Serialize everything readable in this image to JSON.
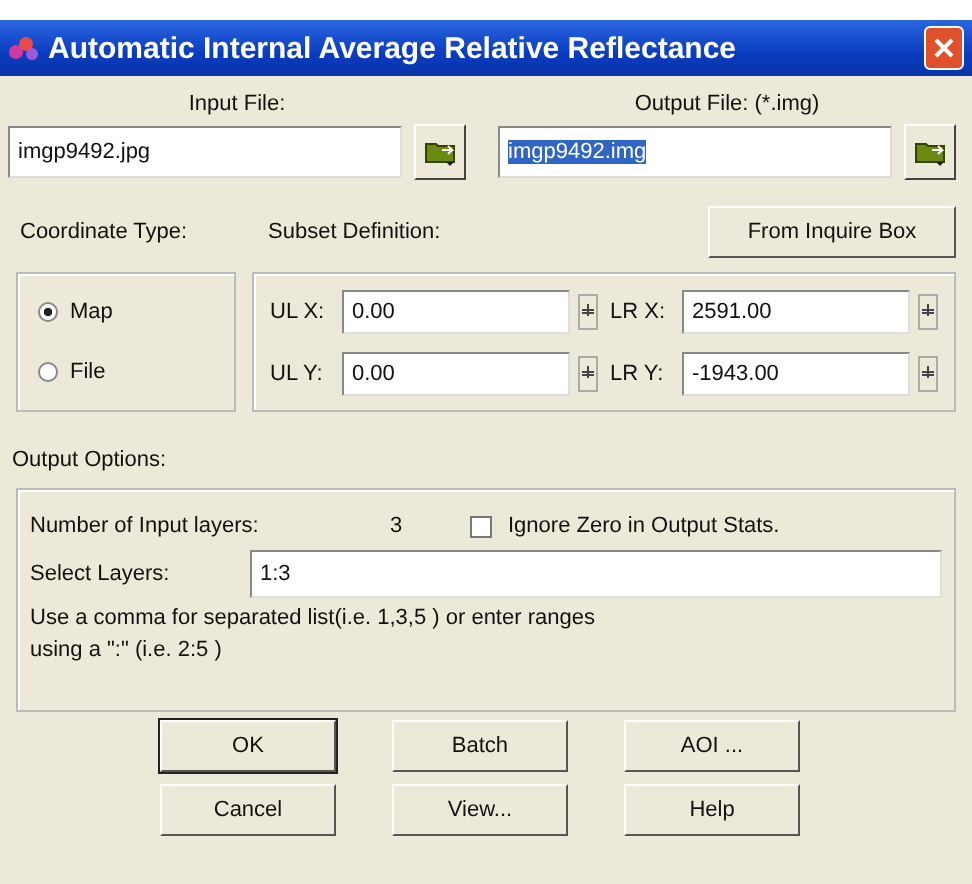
{
  "window": {
    "title": "Automatic Internal Average Relative Reflectance"
  },
  "files": [
    {
      "label": "Input File:",
      "value": "imgp9492.jpg",
      "selected": false
    },
    {
      "label": "Output File: (*.img)",
      "value": "imgp9492.img",
      "selected": true
    }
  ],
  "coordinate_type": {
    "label": "Coordinate Type:",
    "options": [
      {
        "label": "Map",
        "selected": true
      },
      {
        "label": "File",
        "selected": false
      }
    ]
  },
  "subset": {
    "label": "Subset Definition:",
    "button": "From Inquire Box",
    "fields": [
      {
        "label": "UL X:",
        "value": "0.00"
      },
      {
        "label": "LR X:",
        "value": "2591.00"
      },
      {
        "label": "UL Y:",
        "value": "0.00"
      },
      {
        "label": "LR Y:",
        "value": "-1943.00"
      }
    ]
  },
  "output_options": {
    "label": "Output Options:",
    "layers_label": "Number of Input layers:",
    "layers_count": "3",
    "ignore_zero": {
      "label": "Ignore Zero in Output Stats.",
      "checked": false
    },
    "select_label": "Select Layers:",
    "select_value": "1:3",
    "hint": [
      "Use a comma for separated list(i.e. 1,3,5 ) or enter ranges",
      "using a \":\" (i.e. 2:5 )"
    ]
  },
  "buttons": [
    {
      "label": "OK",
      "default": true
    },
    {
      "label": "Batch",
      "default": false
    },
    {
      "label": "AOI ...",
      "default": false
    },
    {
      "label": "Cancel",
      "default": false
    },
    {
      "label": "View...",
      "default": false
    },
    {
      "label": "Help",
      "default": false
    }
  ]
}
